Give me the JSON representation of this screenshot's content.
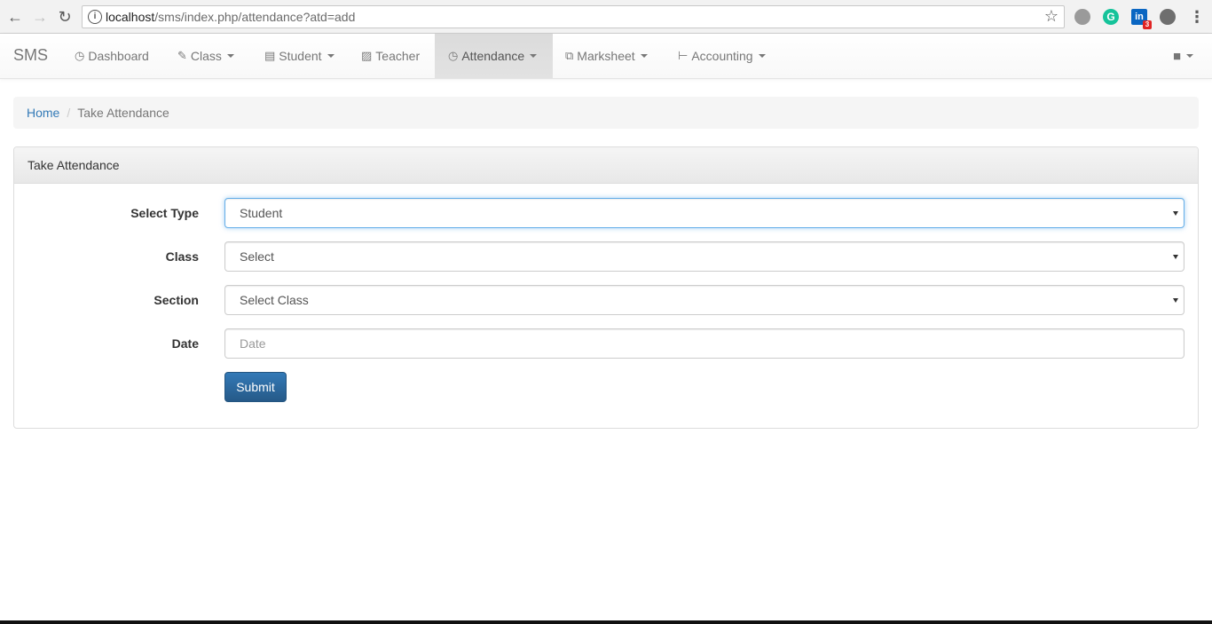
{
  "browser": {
    "url_host": "localhost",
    "url_path": "/sms/index.php/attendance?atd=add",
    "extensions": {
      "grammarly_letter": "G",
      "linkedin_letters": "in",
      "linkedin_badge": "3"
    }
  },
  "navbar": {
    "brand": "SMS",
    "items": [
      {
        "label": "Dashboard",
        "icon": "dashboard-icon",
        "dropdown": false
      },
      {
        "label": "Class",
        "icon": "edit-icon",
        "dropdown": true
      },
      {
        "label": "Student",
        "icon": "list-icon",
        "dropdown": true
      },
      {
        "label": "Teacher",
        "icon": "briefcase-icon",
        "dropdown": false
      },
      {
        "label": "Attendance",
        "icon": "clock-icon",
        "dropdown": true,
        "active": true
      },
      {
        "label": "Marksheet",
        "icon": "copy-icon",
        "dropdown": true
      },
      {
        "label": "Accounting",
        "icon": "tasks-icon",
        "dropdown": true
      }
    ],
    "user_icon": "user-icon"
  },
  "breadcrumb": {
    "home": "Home",
    "current": "Take Attendance"
  },
  "panel": {
    "title": "Take Attendance",
    "fields": {
      "select_type": {
        "label": "Select Type",
        "value": "Student"
      },
      "class": {
        "label": "Class",
        "value": "Select"
      },
      "section": {
        "label": "Section",
        "value": "Select Class"
      },
      "date": {
        "label": "Date",
        "placeholder": "Date"
      }
    },
    "submit_label": "Submit"
  },
  "colors": {
    "link": "#337ab7",
    "primary_button": "#286090",
    "focus_border": "#66afe9"
  }
}
